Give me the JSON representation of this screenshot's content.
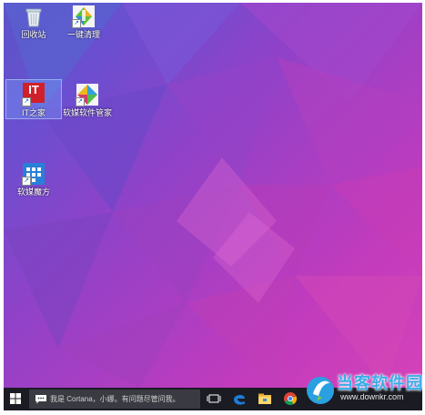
{
  "desktop": {
    "icons": [
      {
        "label": "回收站",
        "icon": "recycle-bin-icon"
      },
      {
        "label": "一键清理",
        "icon": "broom-cleaner-icon"
      },
      {
        "label": "IT之家",
        "icon": "ithome-icon",
        "badge": "IT"
      },
      {
        "label": "软媒软件管家",
        "icon": "software-manager-icon"
      },
      {
        "label": "软媒魔方",
        "icon": "rubik-cube-icon"
      }
    ]
  },
  "taskbar": {
    "search_text": "我是 Cortana，小娜。有问题尽管问我。"
  },
  "watermark": {
    "title": "当客软件园",
    "url": "www.downkr.com"
  },
  "colors": {
    "taskbar": "#1b1b24",
    "edge_blue": "#1e7bd8",
    "ithome_red": "#d0202a"
  }
}
